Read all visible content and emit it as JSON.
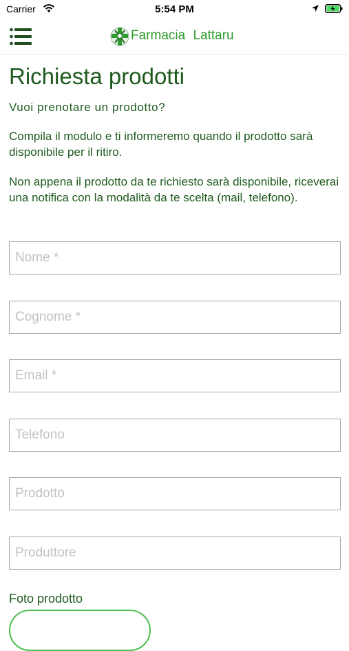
{
  "status_bar": {
    "carrier": "Carrier",
    "time": "5:54 PM",
    "icons": [
      "wifi-icon",
      "location-arrow-icon",
      "battery-charging-icon"
    ]
  },
  "header": {
    "menu_icon": "hamburger-menu-icon",
    "logo_icon": "pharmacy-cross-logo-icon",
    "title": "Farmacia Lattaru",
    "brand_color": "#2e9b2e"
  },
  "content": {
    "title": "Richiesta prodotti",
    "subtitle": "Vuoi prenotare un prodotto?",
    "paragraph1": "Compila il modulo e ti informeremo quando il prodotto sarà disponibile per il ritiro.",
    "paragraph2": "Non appena il prodotto da te richiesto sarà disponibile, riceverai una notifica con la modalità da te scelta (mail, telefono).",
    "text_color": "#1e5a1e"
  },
  "form": {
    "fields": [
      {
        "placeholder": "Nome *",
        "value": ""
      },
      {
        "placeholder": "Cognome *",
        "value": ""
      },
      {
        "placeholder": "Email *",
        "value": ""
      },
      {
        "placeholder": "Telefono",
        "value": ""
      },
      {
        "placeholder": "Prodotto",
        "value": ""
      },
      {
        "placeholder": "Produttore",
        "value": ""
      }
    ],
    "photo_label": "Foto prodotto",
    "button_border_color": "#4cbf4c"
  }
}
